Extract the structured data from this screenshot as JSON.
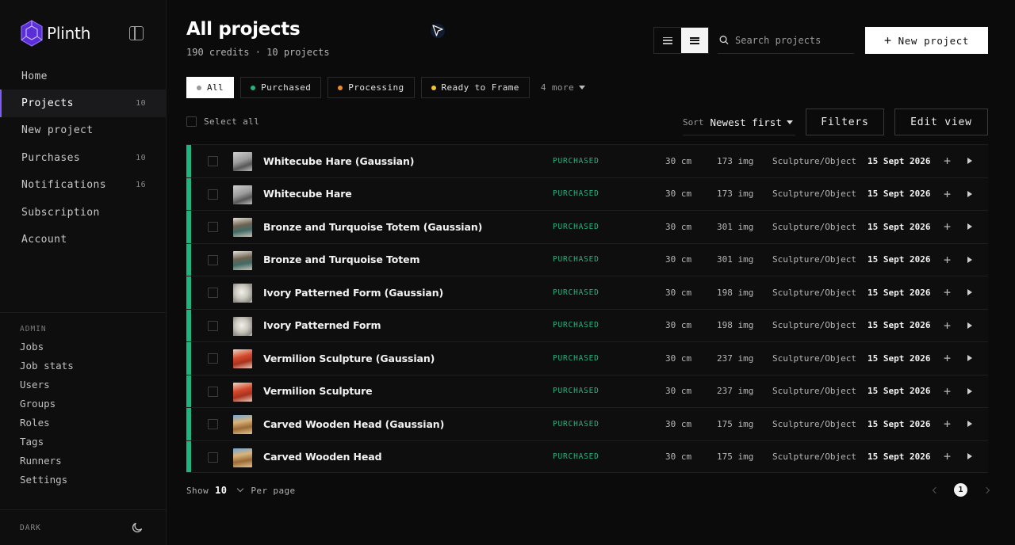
{
  "brand": {
    "name": "Plinth"
  },
  "sidebar": {
    "nav": [
      {
        "label": "Home",
        "count": ""
      },
      {
        "label": "Projects",
        "count": "10"
      },
      {
        "label": "New project",
        "count": ""
      },
      {
        "label": "Purchases",
        "count": "10"
      },
      {
        "label": "Notifications",
        "count": "16"
      },
      {
        "label": "Subscription",
        "count": ""
      },
      {
        "label": "Account",
        "count": ""
      }
    ],
    "admin_title": "ADMIN",
    "admin": [
      "Jobs",
      "Job stats",
      "Users",
      "Groups",
      "Roles",
      "Tags",
      "Runners",
      "Settings"
    ],
    "theme_label": "DARK"
  },
  "header": {
    "title": "All projects",
    "subtitle": "190 credits · 10 projects",
    "search_placeholder": "Search projects",
    "new_project_label": "New project",
    "new_project_icon": "+"
  },
  "filters": {
    "chips": [
      {
        "label": "All",
        "color": "#9a9a9a"
      },
      {
        "label": "Purchased",
        "color": "#1fb57f"
      },
      {
        "label": "Processing",
        "color": "#f08a2c"
      },
      {
        "label": "Ready to Frame",
        "color": "#f2c230"
      }
    ],
    "more_label": "4 more"
  },
  "toolbar": {
    "select_all": "Select all",
    "sort_label": "Sort",
    "sort_value": "Newest first",
    "filters_button": "Filters",
    "edit_view_button": "Edit view"
  },
  "projects": [
    {
      "name": "Whitecube Hare (Gaussian)",
      "status": "PURCHASED",
      "size": "30 cm",
      "images": "173 img",
      "type": "Sculpture/Object",
      "date": "15 Sept 2026",
      "thumb": "grey"
    },
    {
      "name": "Whitecube Hare",
      "status": "PURCHASED",
      "size": "30 cm",
      "images": "173 img",
      "type": "Sculpture/Object",
      "date": "15 Sept 2026",
      "thumb": "grey"
    },
    {
      "name": "Bronze and Turquoise Totem (Gaussian)",
      "status": "PURCHASED",
      "size": "30 cm",
      "images": "301 img",
      "type": "Sculpture/Object",
      "date": "15 Sept 2026",
      "thumb": "bronze"
    },
    {
      "name": "Bronze and Turquoise Totem",
      "status": "PURCHASED",
      "size": "30 cm",
      "images": "301 img",
      "type": "Sculpture/Object",
      "date": "15 Sept 2026",
      "thumb": "bronze"
    },
    {
      "name": "Ivory Patterned Form (Gaussian)",
      "status": "PURCHASED",
      "size": "30 cm",
      "images": "198 img",
      "type": "Sculpture/Object",
      "date": "15 Sept 2026",
      "thumb": "ivory"
    },
    {
      "name": "Ivory Patterned Form",
      "status": "PURCHASED",
      "size": "30 cm",
      "images": "198 img",
      "type": "Sculpture/Object",
      "date": "15 Sept 2026",
      "thumb": "ivory"
    },
    {
      "name": "Vermilion Sculpture (Gaussian)",
      "status": "PURCHASED",
      "size": "30 cm",
      "images": "237 img",
      "type": "Sculpture/Object",
      "date": "15 Sept 2026",
      "thumb": "vermilion"
    },
    {
      "name": "Vermilion Sculpture",
      "status": "PURCHASED",
      "size": "30 cm",
      "images": "237 img",
      "type": "Sculpture/Object",
      "date": "15 Sept 2026",
      "thumb": "vermilion"
    },
    {
      "name": "Carved Wooden Head (Gaussian)",
      "status": "PURCHASED",
      "size": "30 cm",
      "images": "175 img",
      "type": "Sculpture/Object",
      "date": "15 Sept 2026",
      "thumb": "wood"
    },
    {
      "name": "Carved Wooden Head",
      "status": "PURCHASED",
      "size": "30 cm",
      "images": "175 img",
      "type": "Sculpture/Object",
      "date": "15 Sept 2026",
      "thumb": "wood"
    }
  ],
  "footer": {
    "show_label": "Show",
    "show_value": "10",
    "per_page": "Per page",
    "current_page": "1"
  },
  "colors": {
    "accent": "#7d5cff",
    "purchased": "#1fb57f"
  }
}
